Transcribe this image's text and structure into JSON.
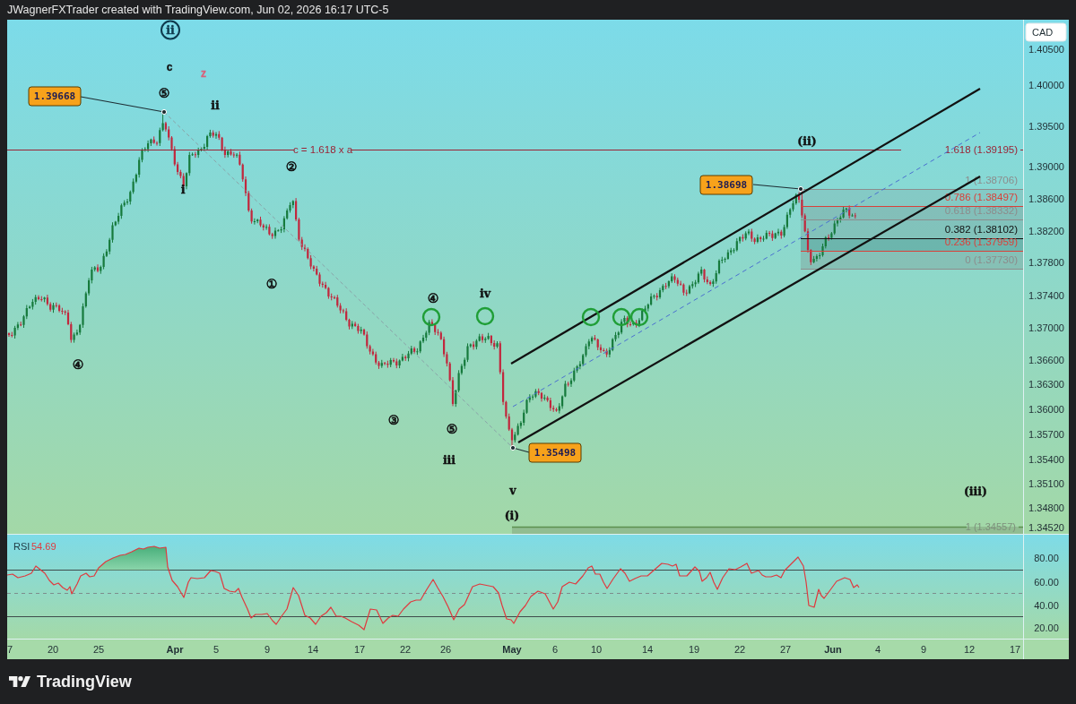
{
  "header": {
    "title": "JWagnerFXTrader created with TradingView.com, Jun 02, 2026 16:17 UTC-5"
  },
  "chart": {
    "currency": "CAD",
    "price_axis": [
      "1.40500",
      "1.40000",
      "1.39500",
      "1.39000",
      "1.38600",
      "1.38200",
      "1.37800",
      "1.37400",
      "1.37000",
      "1.36600",
      "1.36300",
      "1.36000",
      "1.35700",
      "1.35400",
      "1.35100",
      "1.34800",
      "1.34520"
    ],
    "level_line": {
      "label": "c = 1.618 x a",
      "value_label": "1.618 (1.39195)"
    },
    "fib_retracement": [
      {
        "label": "1 (1.38706)",
        "color": "#8c8c8c"
      },
      {
        "label": "0.786 (1.38497)",
        "color": "#d9413a"
      },
      {
        "label": "0.618 (1.38332)",
        "color": "#8c8c8c"
      },
      {
        "label": "0.382 (1.38102)",
        "color": "#111111"
      },
      {
        "label": "0.236 (1.37959)",
        "color": "#d9413a"
      },
      {
        "label": "0 (1.37730)",
        "color": "#8c8c8c"
      }
    ],
    "fib_extension": {
      "label": "1 (1.34557)"
    },
    "price_callouts": [
      "1.39668",
      "1.38698",
      "1.35498"
    ],
    "wave_labels": [
      {
        "text": "ii",
        "kind": "circled",
        "color": "#0e3a4d"
      },
      {
        "text": "c",
        "kind": "letter",
        "color": "#111111"
      },
      {
        "text": "z",
        "kind": "letter",
        "color": "#d9607a"
      },
      {
        "text": "⑤",
        "kind": "digit",
        "color": "#111111"
      },
      {
        "text": "ii",
        "kind": "roman",
        "color": "#111111"
      },
      {
        "text": "i",
        "kind": "roman",
        "color": "#111111"
      },
      {
        "text": "②",
        "kind": "digit",
        "color": "#111111"
      },
      {
        "text": "①",
        "kind": "digit",
        "color": "#111111"
      },
      {
        "text": "④",
        "kind": "digit",
        "color": "#111111"
      },
      {
        "text": "④",
        "kind": "digit",
        "color": "#111111"
      },
      {
        "text": "iv",
        "kind": "roman",
        "color": "#111111"
      },
      {
        "text": "③",
        "kind": "digit",
        "color": "#111111"
      },
      {
        "text": "⑤",
        "kind": "digit",
        "color": "#111111"
      },
      {
        "text": "iii",
        "kind": "roman",
        "color": "#111111"
      },
      {
        "text": "v",
        "kind": "roman",
        "color": "#111111"
      },
      {
        "text": "(i)",
        "kind": "roman",
        "color": "#111111"
      },
      {
        "text": "(ii)",
        "kind": "roman",
        "color": "#111111"
      },
      {
        "text": "(iii)",
        "kind": "roman",
        "color": "#111111"
      }
    ]
  },
  "indicator": {
    "name": "RSI",
    "value": "54.69",
    "axis": [
      "80.00",
      "60.00",
      "40.00",
      "20.00"
    ]
  },
  "time_axis": [
    {
      "text": "7",
      "kind": "day"
    },
    {
      "text": "20",
      "kind": "day"
    },
    {
      "text": "25",
      "kind": "day"
    },
    {
      "text": "Apr",
      "kind": "month"
    },
    {
      "text": "5",
      "kind": "day"
    },
    {
      "text": "9",
      "kind": "day"
    },
    {
      "text": "14",
      "kind": "day"
    },
    {
      "text": "17",
      "kind": "day"
    },
    {
      "text": "22",
      "kind": "day"
    },
    {
      "text": "26",
      "kind": "day"
    },
    {
      "text": "May",
      "kind": "month"
    },
    {
      "text": "6",
      "kind": "day"
    },
    {
      "text": "10",
      "kind": "day"
    },
    {
      "text": "14",
      "kind": "day"
    },
    {
      "text": "19",
      "kind": "day"
    },
    {
      "text": "22",
      "kind": "day"
    },
    {
      "text": "27",
      "kind": "day"
    },
    {
      "text": "Jun",
      "kind": "month"
    },
    {
      "text": "4",
      "kind": "day"
    },
    {
      "text": "9",
      "kind": "day"
    },
    {
      "text": "12",
      "kind": "day"
    },
    {
      "text": "17",
      "kind": "day"
    }
  ],
  "footer": {
    "logo": "TradingView"
  }
}
